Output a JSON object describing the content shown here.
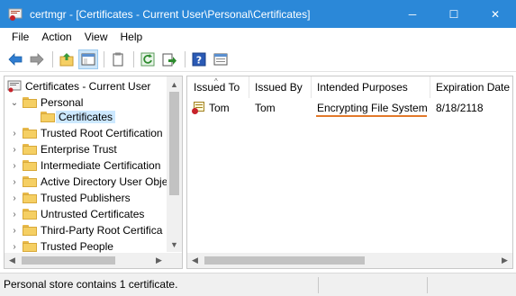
{
  "window": {
    "title": "certmgr - [Certificates - Current User\\Personal\\Certificates]",
    "icon": "certmgr-icon",
    "controls": {
      "minimize": "─",
      "maximize": "☐",
      "close": "✕"
    }
  },
  "menu": [
    "File",
    "Action",
    "View",
    "Help"
  ],
  "toolbar": {
    "icons": [
      "back-arrow-icon",
      "forward-arrow-icon",
      "up-folder-icon",
      "show-hide-tree-icon",
      "properties-icon",
      "refresh-icon",
      "export-list-icon",
      "help-icon",
      "console-view-icon"
    ]
  },
  "tree": {
    "root": "Certificates - Current User",
    "personal": "Personal",
    "selected": "Certificates",
    "items": [
      "Trusted Root Certification",
      "Enterprise Trust",
      "Intermediate Certification",
      "Active Directory User Obje",
      "Trusted Publishers",
      "Untrusted Certificates",
      "Third-Party Root Certifica",
      "Trusted People"
    ]
  },
  "list": {
    "columns": [
      "Issued To",
      "Issued By",
      "Intended Purposes",
      "Expiration Date"
    ],
    "rows": [
      {
        "issued_to": "Tom",
        "issued_by": "Tom",
        "purposes": "Encrypting File System",
        "expiration": "8/18/2118"
      }
    ]
  },
  "status": {
    "text": "Personal store contains 1 certificate."
  },
  "colors": {
    "titlebar": "#2b88d8",
    "selection": "#cce8ff",
    "highlight_underline": "#e2792a"
  }
}
